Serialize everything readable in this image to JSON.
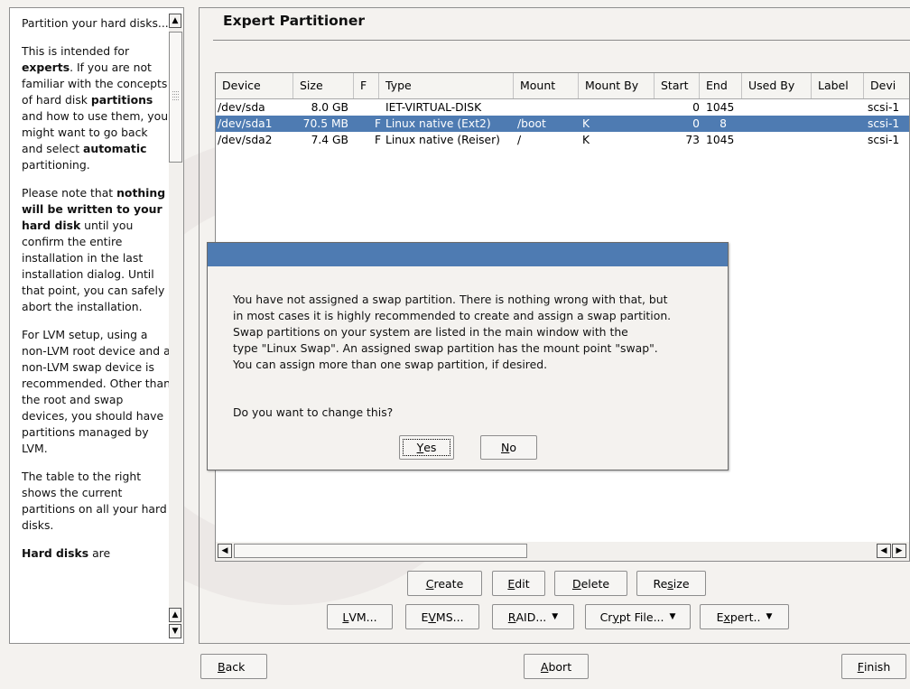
{
  "help": {
    "p1": "Partition your hard disks...",
    "p2_a": "This is intended for ",
    "p2_b": "experts",
    "p2_c": ". If you are not familiar with the concepts of hard disk ",
    "p2_d": "partitions",
    "p2_e": " and how to use them, you might want to go back and select ",
    "p2_f": "automatic",
    "p2_g": " partitioning.",
    "p3_a": "Please note that ",
    "p3_b": "nothing will be written to your hard disk",
    "p3_c": " until you confirm the entire installation in the last installation dialog. Until that point, you can safely abort the installation.",
    "p4": "For LVM setup, using a non-LVM root device and a non-LVM swap device is recommended. Other than the root and swap devices, you should have partitions managed by LVM.",
    "p5": "The table to the right shows the current partitions on all your hard disks.",
    "p6_a": "Hard disks",
    "p6_b": " are"
  },
  "main": {
    "title": "Expert Partitioner"
  },
  "table": {
    "columns": [
      "Device",
      "Size",
      "F",
      "Type",
      "Mount",
      "Mount By",
      "Start",
      "End",
      "Used By",
      "Label",
      "Devi"
    ],
    "rows": [
      {
        "device": "/dev/sda",
        "size": "8.0 GB",
        "f": "",
        "type": "IET-VIRTUAL-DISK",
        "mount": "",
        "mount_by": "",
        "start": "0",
        "end": "1045",
        "used_by": "",
        "label": "",
        "dev": "scsi-1"
      },
      {
        "device": "/dev/sda1",
        "size": "70.5 MB",
        "f": "F",
        "type": "Linux native (Ext2)",
        "mount": "/boot",
        "mount_by": "K",
        "start": "0",
        "end": "8",
        "used_by": "",
        "label": "",
        "dev": "scsi-1"
      },
      {
        "device": "/dev/sda2",
        "size": "7.4 GB",
        "f": "F",
        "type": "Linux native (Reiser)",
        "mount": "/",
        "mount_by": "K",
        "start": "73",
        "end": "1045",
        "used_by": "",
        "label": "",
        "dev": "scsi-1"
      }
    ],
    "selected_row": 1
  },
  "buttons": {
    "create_u": "C",
    "create_r": "reate",
    "edit_u": "E",
    "edit_r": "dit",
    "delete_u": "D",
    "delete_r": "elete",
    "resize_l": "Re",
    "resize_u": "s",
    "resize_r": "ize",
    "lvm_u": "L",
    "lvm_r": "VM...",
    "evms_l": "E",
    "evms_u": "V",
    "evms_r": "MS...",
    "raid_u": "R",
    "raid_r": "AID...",
    "crypt_l": "Cr",
    "crypt_u": "y",
    "crypt_r": "pt File...",
    "expert_l": "E",
    "expert_u": "x",
    "expert_r": "pert..",
    "back_u": "B",
    "back_r": "ack",
    "abort_u": "A",
    "abort_r": "bort",
    "finish_u": "F",
    "finish_r": "inish"
  },
  "dialog": {
    "message": "You have not assigned a swap partition. There is nothing wrong with that, but\nin most cases it is highly recommended to create and assign a swap partition.\nSwap partitions on your system are listed in the main window with the\ntype \"Linux Swap\". An assigned swap partition has the mount point \"swap\".\nYou can assign more than one swap partition, if desired.",
    "question": "Do you want to change this?",
    "yes_u": "Y",
    "yes_r": "es",
    "no_u": "N",
    "no_r": "o"
  },
  "colors": {
    "selection": "#4e7bb2",
    "dialog_title": "#4e7bb2",
    "background": "#f4f2ef"
  },
  "icons": {
    "scroll_up": "triangle-up-icon",
    "scroll_down": "triangle-down-icon",
    "scroll_left": "triangle-left-icon",
    "scroll_right": "triangle-right-icon",
    "dropdown": "caret-down-icon"
  }
}
